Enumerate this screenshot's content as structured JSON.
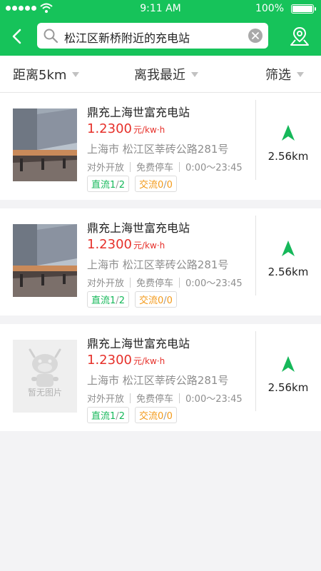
{
  "status": {
    "time": "9:11 AM",
    "battery": "100%"
  },
  "search": {
    "query": "松江区新桥附近的充电站"
  },
  "filters": {
    "distance": "距离5km",
    "sort": "离我最近",
    "filter": "筛选"
  },
  "stations": [
    {
      "name": "鼎充上海世富充电站",
      "price": "1.2300",
      "unit": "元/kw·h",
      "address": "上海市 松江区莘砖公路281号",
      "access": "对外开放",
      "parking": "免费停车",
      "hours": "0:00～23:45",
      "dc_label": "直流",
      "dc_free": "1",
      "dc_total": "2",
      "ac_label": "交流",
      "ac_free": "0",
      "ac_total": "0",
      "distance": "2.56km",
      "has_image": true
    },
    {
      "name": "鼎充上海世富充电站",
      "price": "1.2300",
      "unit": "元/kw·h",
      "address": "上海市 松江区莘砖公路281号",
      "access": "对外开放",
      "parking": "免费停车",
      "hours": "0:00～23:45",
      "dc_label": "直流",
      "dc_free": "1",
      "dc_total": "2",
      "ac_label": "交流",
      "ac_free": "0",
      "ac_total": "0",
      "distance": "2.56km",
      "has_image": true
    },
    {
      "name": "鼎充上海世富充电站",
      "price": "1.2300",
      "unit": "元/kw·h",
      "address": "上海市 松江区莘砖公路281号",
      "access": "对外开放",
      "parking": "免费停车",
      "hours": "0:00～23:45",
      "dc_label": "直流",
      "dc_free": "1",
      "dc_total": "2",
      "ac_label": "交流",
      "ac_free": "0",
      "ac_total": "0",
      "distance": "2.56km",
      "has_image": false,
      "placeholder_text": "暂无图片"
    }
  ],
  "colors": {
    "brand": "#16c35a",
    "price": "#e6302a",
    "dc": "#16b85a",
    "ac": "#f39a1a"
  }
}
